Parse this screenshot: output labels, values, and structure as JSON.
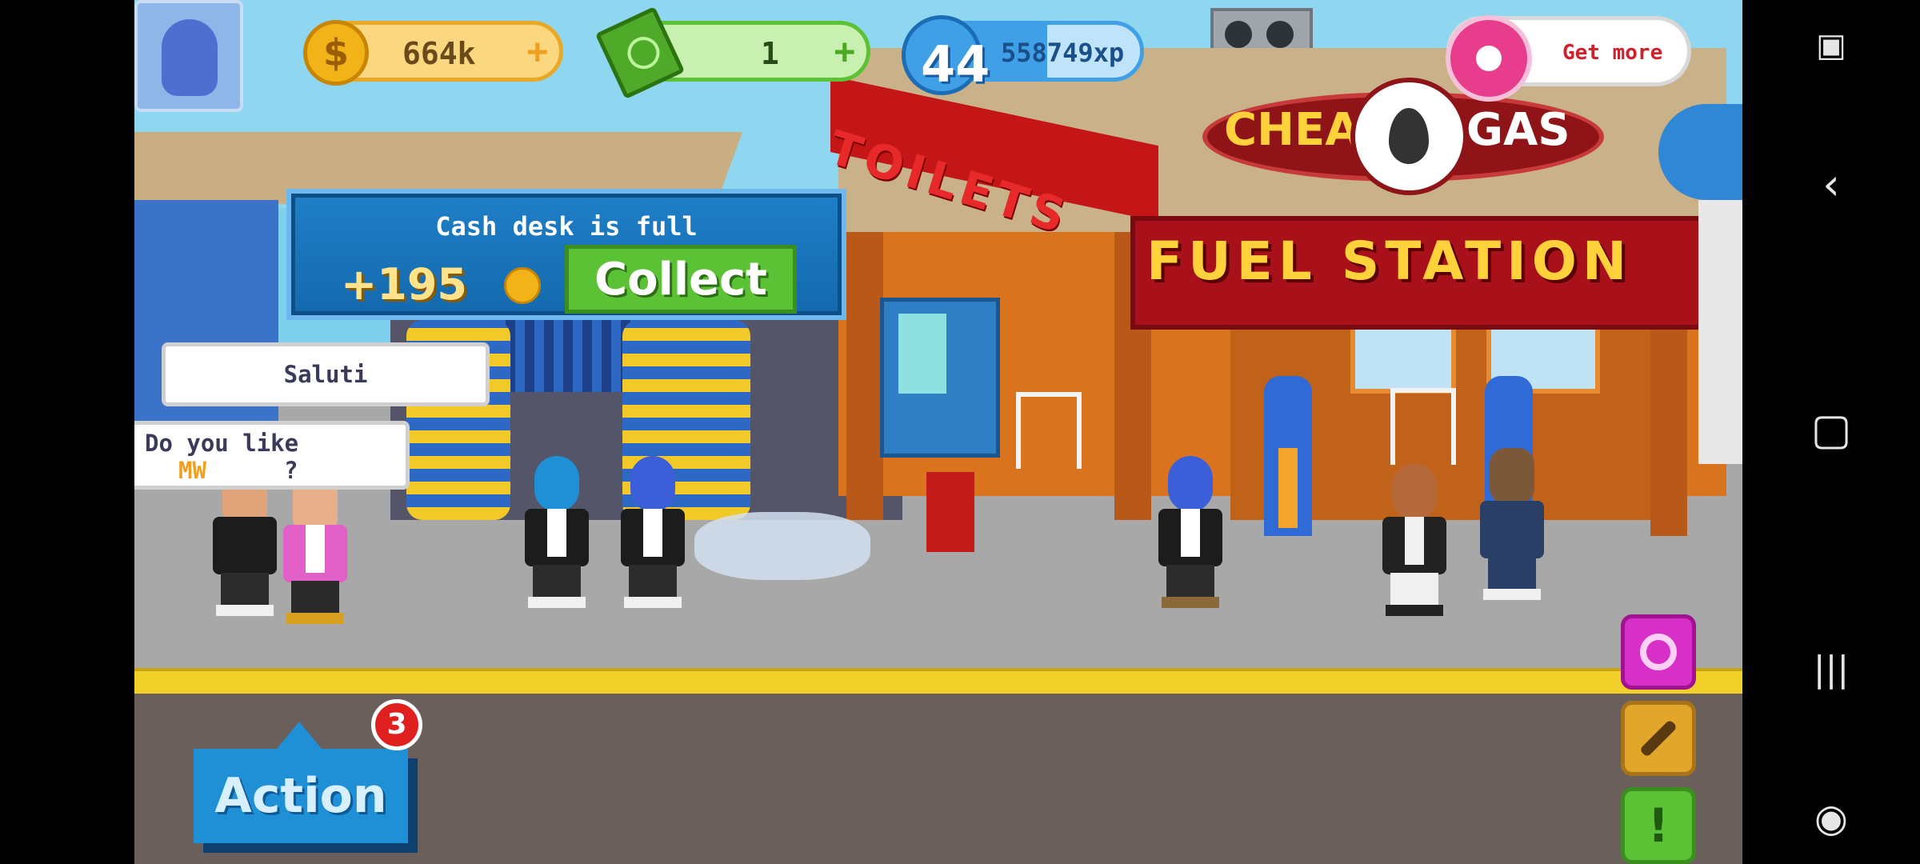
{
  "hud": {
    "coins": "664k",
    "cash": "1",
    "level": "44",
    "xp": "558749xp",
    "donut_label": "Get more",
    "plus": "+",
    "colors": {
      "coin": "#f2b318",
      "cash": "#4faa2a",
      "level": "#3fa0e8",
      "donut": "#e83d8d"
    }
  },
  "popup": {
    "title": "Cash desk is full",
    "amount": "+195",
    "collect_label": "Collect"
  },
  "scene": {
    "sign_left": "CHEAP",
    "sign_right": "GAS",
    "toilets_label": "TOILETS",
    "fuel_station_label": "FUEL STATION"
  },
  "speech": {
    "bubble1": "Saluti",
    "bubble2_line1": "Do you like",
    "bubble2_word": "MW",
    "bubble2_tail": "?"
  },
  "action": {
    "label": "Action",
    "badge_count": "3"
  },
  "side_buttons": [
    {
      "name": "purple-ring-button",
      "color": "#d630c8"
    },
    {
      "name": "wrench-button",
      "color": "#e2a62a"
    },
    {
      "name": "alert-button",
      "color": "#5bc236"
    }
  ],
  "icons": [
    "screen-record-icon",
    "back-icon",
    "home-icon",
    "recents-icon",
    "game-controller-icon"
  ]
}
